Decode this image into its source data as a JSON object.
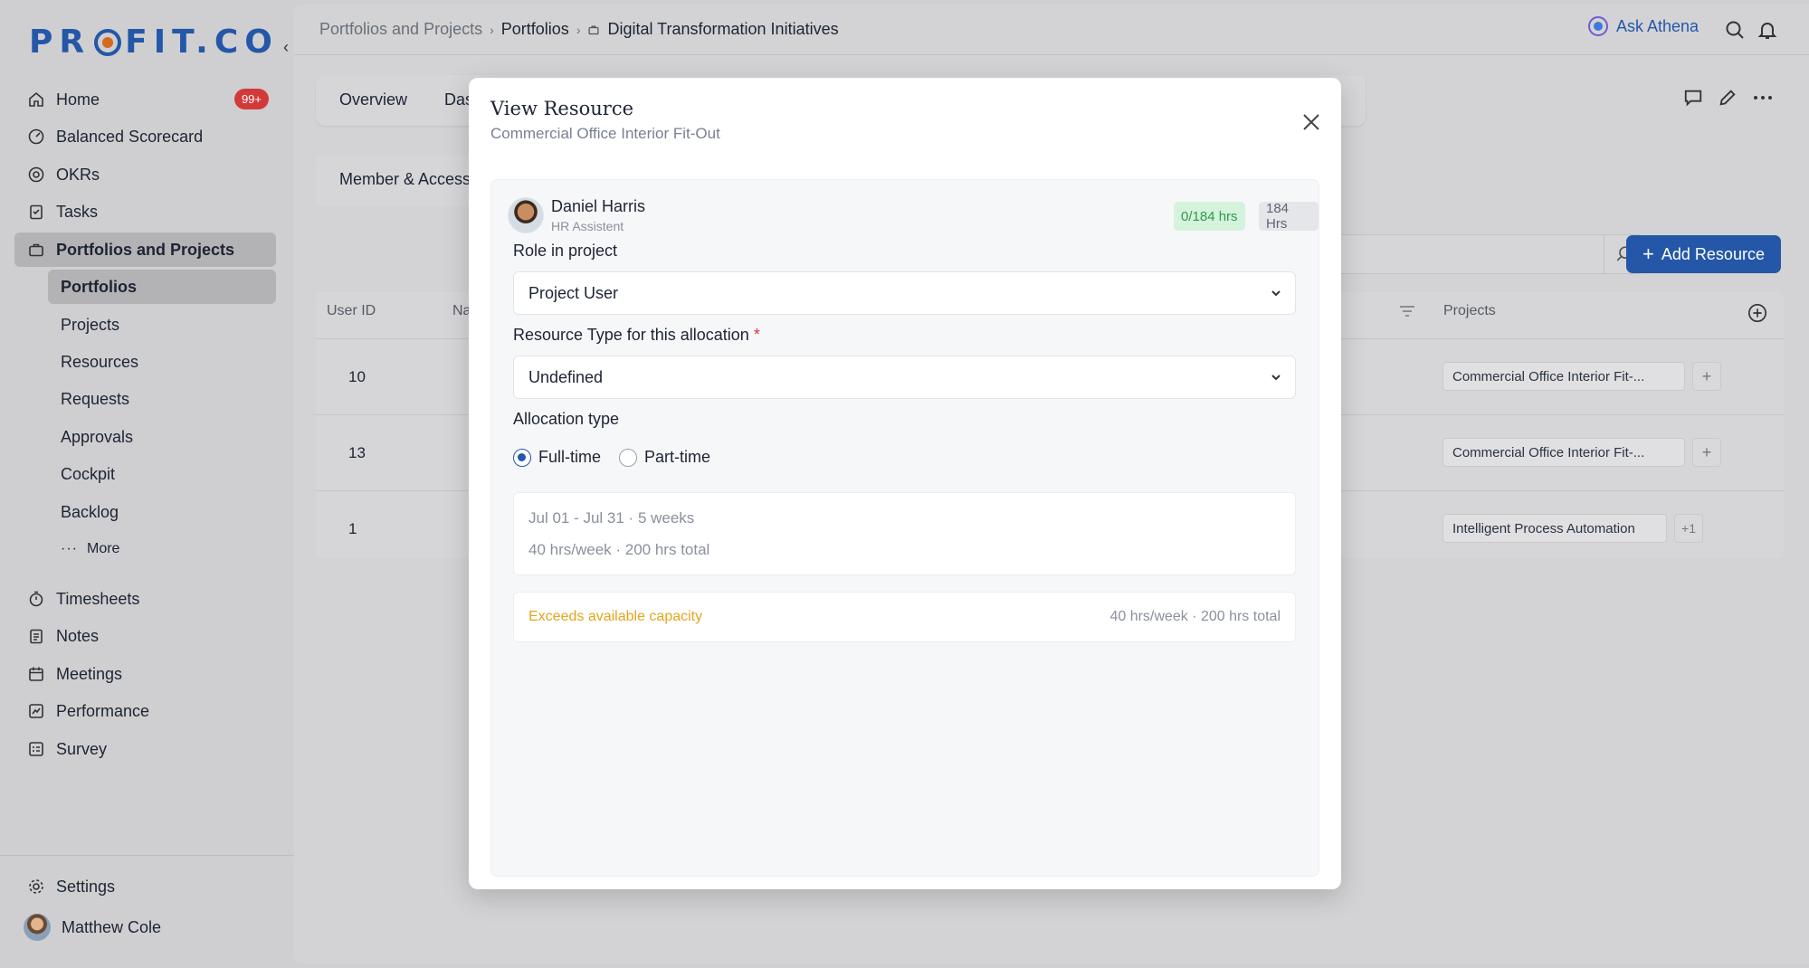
{
  "app": {
    "logo_text": "PROFIT.CO",
    "brand_color": "#2457a7"
  },
  "sidebar": {
    "items": [
      {
        "label": "Home",
        "icon": "home-icon",
        "badge": "99+"
      },
      {
        "label": "Balanced Scorecard",
        "icon": "scorecard-icon"
      },
      {
        "label": "OKRs",
        "icon": "target-icon"
      },
      {
        "label": "Tasks",
        "icon": "clipboard-icon"
      },
      {
        "label": "Portfolios and Projects",
        "icon": "briefcase-icon",
        "active": true
      }
    ],
    "sub_items": [
      "Portfolios",
      "Projects",
      "Resources",
      "Requests",
      "Approvals",
      "Cockpit",
      "Backlog",
      "More"
    ],
    "items2": [
      {
        "label": "Timesheets",
        "icon": "stopwatch-icon"
      },
      {
        "label": "Notes",
        "icon": "notes-icon"
      },
      {
        "label": "Meetings",
        "icon": "calendar-icon"
      },
      {
        "label": "Performance",
        "icon": "chart-icon"
      },
      {
        "label": "Survey",
        "icon": "survey-icon"
      }
    ],
    "settings": "Settings",
    "user": "Matthew Cole"
  },
  "breadcrumb": {
    "level1": "Portfolios and Projects",
    "level2": "Portfolios",
    "level3": "Digital Transformation Initiatives"
  },
  "header": {
    "ask_athena": "Ask Athena"
  },
  "tabs": {
    "overview": "Overview",
    "dashboard": "Das"
  },
  "subtab": {
    "member_access": "Member & Access"
  },
  "toolbar": {
    "add_resource": "Add Resource"
  },
  "table": {
    "headers": {
      "user_id": "User ID",
      "name": "Na",
      "projects": "Projects"
    },
    "rows": [
      {
        "id": "10",
        "project": "Commercial Office Interior Fit-..."
      },
      {
        "id": "13",
        "project": "Commercial Office Interior Fit-..."
      },
      {
        "id": "1",
        "project": "Intelligent Process Automation",
        "extra": "+1"
      }
    ]
  },
  "modal": {
    "title": "View Resource",
    "subtitle": "Commercial Office Interior Fit-Out",
    "person": {
      "name": "Daniel Harris",
      "role": "HR Assistent",
      "allocated": "0/184 hrs",
      "capacity": "184 Hrs"
    },
    "role_label": "Role in project",
    "role_value": "Project User",
    "resource_type_label": "Resource Type for this allocation",
    "required_mark": "*",
    "resource_type_value": "Undefined",
    "allocation_label": "Allocation type",
    "allocation_options": [
      "Full-time",
      "Part-time"
    ],
    "allocation_selected": "Full-time",
    "summary_dates": "Jul 01 - Jul 31 · 5 weeks",
    "summary_hours": "40 hrs/week · 200 hrs total",
    "warning": "Exceeds available capacity",
    "warning_detail": "40 hrs/week · 200 hrs total"
  }
}
